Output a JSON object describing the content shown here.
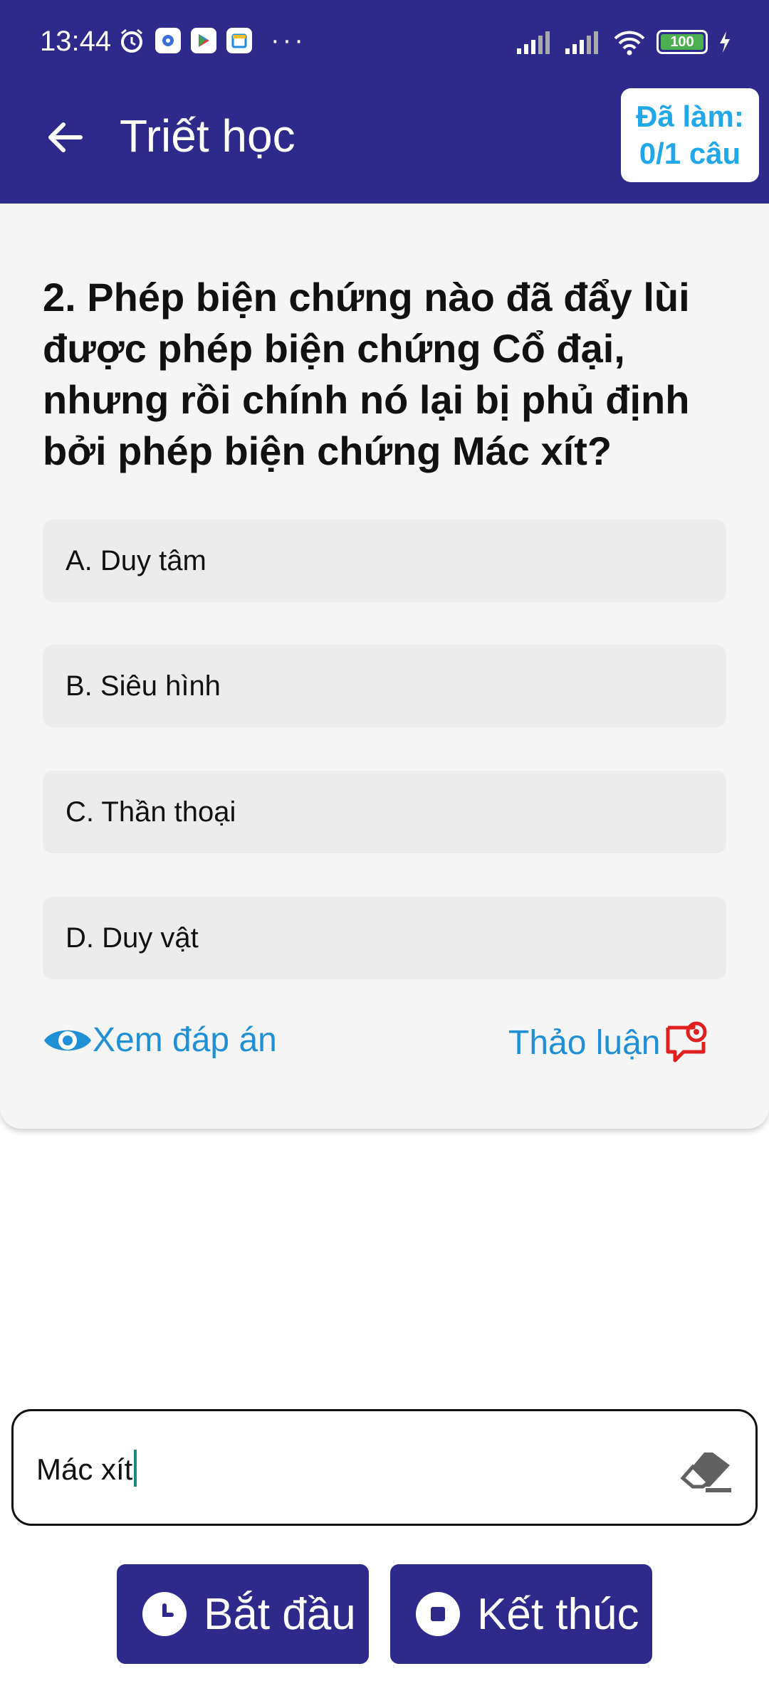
{
  "status_bar": {
    "time": "13:44",
    "battery": "100",
    "icons": [
      "alarm-icon",
      "settings-app-icon",
      "play-store-icon",
      "calendar-icon",
      "more-dots-icon",
      "signal-icon",
      "signal-icon",
      "wifi-icon",
      "battery-icon",
      "charging-icon"
    ]
  },
  "app_bar": {
    "title": "Triết học",
    "progress_line1": "Đã làm:",
    "progress_line2": "0/1 câu",
    "colors": {
      "bar": "#2e2a8c",
      "progress_text": "#22a8e8"
    }
  },
  "question": {
    "text": "2. Phép biện chứng nào đã đẩy lùi được phép biện chứng Cổ đại, nhưng rồi chính nó lại bị phủ định bởi phép biện chứng Mác xít?",
    "options": [
      "A. Duy tâm",
      "B. Siêu hình",
      "C. Thần thoại",
      "D. Duy vật"
    ],
    "show_answer_label": "Xem đáp án",
    "discuss_label": "Thảo luận"
  },
  "search": {
    "value": "Mác xít"
  },
  "buttons": {
    "start_label": "Bắt đầu",
    "end_label": "Kết thúc"
  }
}
